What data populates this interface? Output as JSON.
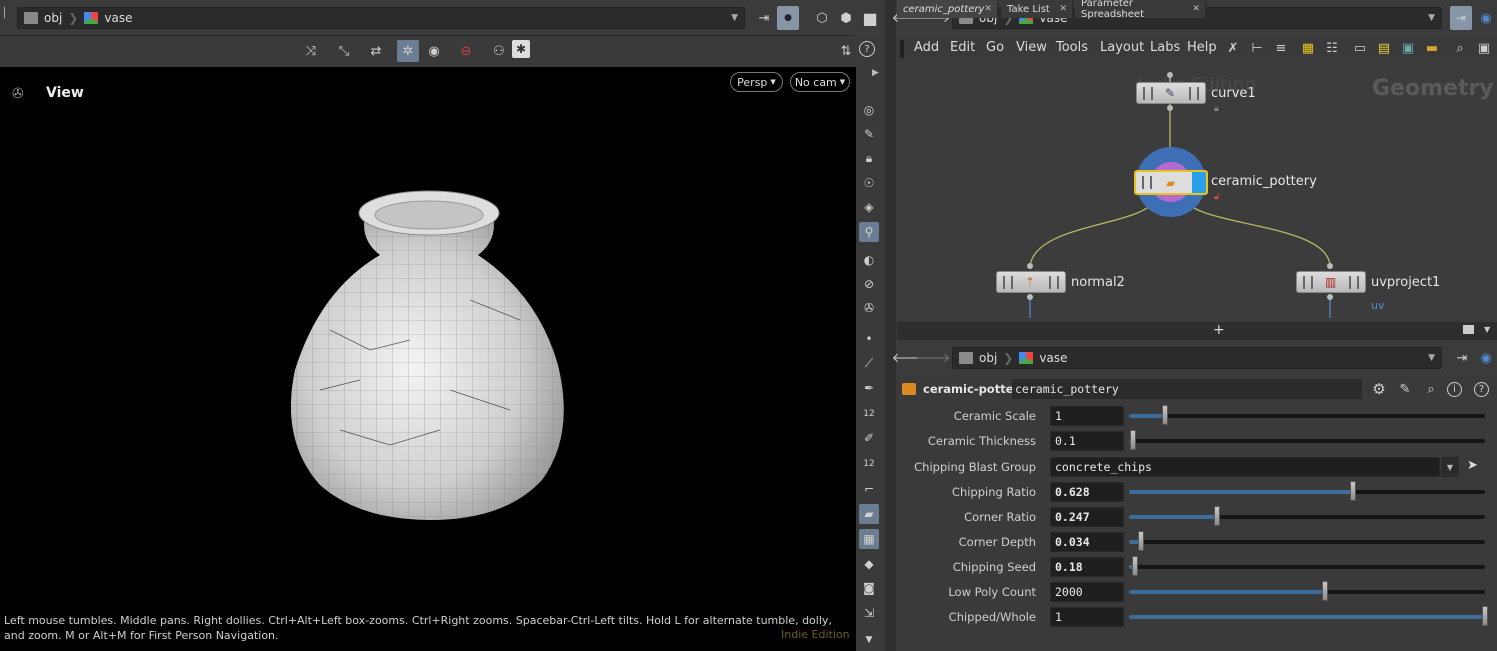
{
  "viewer": {
    "path": [
      "obj",
      "vase"
    ],
    "panel_title": "View",
    "persp_label": "Persp",
    "cam_label": "No cam",
    "help_text": "Left mouse tumbles. Middle pans. Right dollies. Ctrl+Alt+Left box-zooms. Ctrl+Right zooms. Spacebar-Ctrl-Left tilts. Hold L for alternate tumble, dolly, and zoom. M or Alt+M for First Person Navigation.",
    "watermark": "Indie Edition"
  },
  "network": {
    "path": [
      "obj",
      "vase"
    ],
    "menu": [
      "Add",
      "Edit",
      "Go",
      "View",
      "Tools",
      "Layout",
      "Labs",
      "Help"
    ],
    "context_label": "Geometry",
    "watermark": "Indie Edition",
    "nodes": [
      {
        "name": "curve1"
      },
      {
        "name": "ceramic_pottery"
      },
      {
        "name": "normal2"
      },
      {
        "name": "uvproject1",
        "flag": "uv"
      }
    ]
  },
  "params": {
    "tabs": [
      {
        "label": "ceramic_pottery"
      },
      {
        "label": "Take List"
      },
      {
        "label": "Parameter Spreadsheet"
      }
    ],
    "add_tab": "+",
    "path": [
      "obj",
      "vase"
    ],
    "node_type": "ceramic-pottery",
    "node_name": "ceramic_pottery",
    "rows": [
      {
        "label": "Ceramic Scale",
        "value": "1",
        "slider": 0.1
      },
      {
        "label": "Ceramic Thickness",
        "value": "0.1",
        "slider": 0.01
      },
      {
        "label": "Chipping Blast Group",
        "value": "concrete_chips"
      },
      {
        "label": "Chipping Ratio",
        "value": "0.628",
        "slider": 0.628
      },
      {
        "label": "Corner Ratio",
        "value": "0.247",
        "slider": 0.247
      },
      {
        "label": "Corner Depth",
        "value": "0.034",
        "slider": 0.034
      },
      {
        "label": "Chipping Seed",
        "value": "0.18",
        "slider": 0.018
      },
      {
        "label": "Low Poly Count",
        "value": "2000",
        "slider": 0.55
      },
      {
        "label": "Chipped/Whole",
        "value": "1",
        "slider": 1.0
      }
    ]
  },
  "colors": {
    "accent": "#4f8bd0",
    "selected": "#e8c320",
    "viewport_bg": "#000000"
  }
}
